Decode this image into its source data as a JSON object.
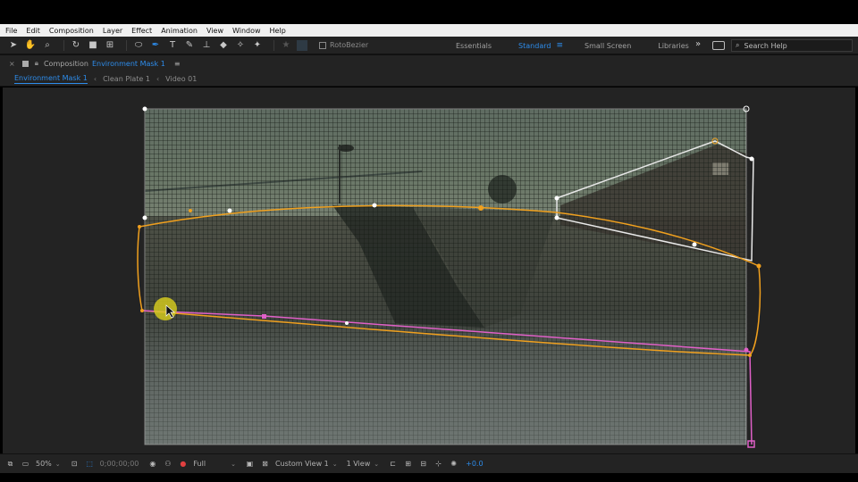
{
  "menubar": {
    "items": [
      "File",
      "Edit",
      "Composition",
      "Layer",
      "Effect",
      "Animation",
      "View",
      "Window",
      "Help"
    ]
  },
  "toolbar": {
    "tools": [
      {
        "name": "selection-tool-icon",
        "glyph": "➤"
      },
      {
        "name": "hand-tool-icon",
        "glyph": "✋"
      },
      {
        "name": "zoom-tool-icon",
        "glyph": "⌕"
      },
      {
        "name": "rotate-tool-icon",
        "glyph": "↻"
      },
      {
        "name": "camera-tool-icon",
        "glyph": "■"
      },
      {
        "name": "pan-behind-tool-icon",
        "glyph": "⊞"
      },
      {
        "name": "ellipse-tool-icon",
        "glyph": "⬭"
      },
      {
        "name": "pen-tool-icon",
        "glyph": "✒",
        "active": true
      },
      {
        "name": "type-tool-icon",
        "glyph": "T"
      },
      {
        "name": "brush-tool-icon",
        "glyph": "✎"
      },
      {
        "name": "clone-stamp-tool-icon",
        "glyph": "⊥"
      },
      {
        "name": "eraser-tool-icon",
        "glyph": "◆"
      },
      {
        "name": "roto-brush-tool-icon",
        "glyph": "✧"
      },
      {
        "name": "puppet-pin-tool-icon",
        "glyph": "📌"
      }
    ],
    "rotobezier_label": "RotoBezier",
    "workspaces": [
      "Essentials",
      "Standard",
      "Small Screen",
      "Libraries"
    ],
    "active_workspace": "Standard",
    "search_placeholder": "Search Help"
  },
  "panel": {
    "type_label": "Composition",
    "name": "Environment Mask 1"
  },
  "breadcrumbs": [
    "Environment Mask 1",
    "Clean Plate 1",
    "Video 01"
  ],
  "statusbar": {
    "zoom": "50%",
    "timecode": "0;00;00;00",
    "resolution": "Full",
    "view": "Custom View 1",
    "views_count": "1 View",
    "exposure": "+0.0"
  },
  "colors": {
    "accent": "#2d8ceb",
    "mask_orange": "#f0a01e",
    "mask_white": "#e8e8e8",
    "mask_pink": "#e060c8",
    "cursor_yellow": "#d2c81e"
  }
}
